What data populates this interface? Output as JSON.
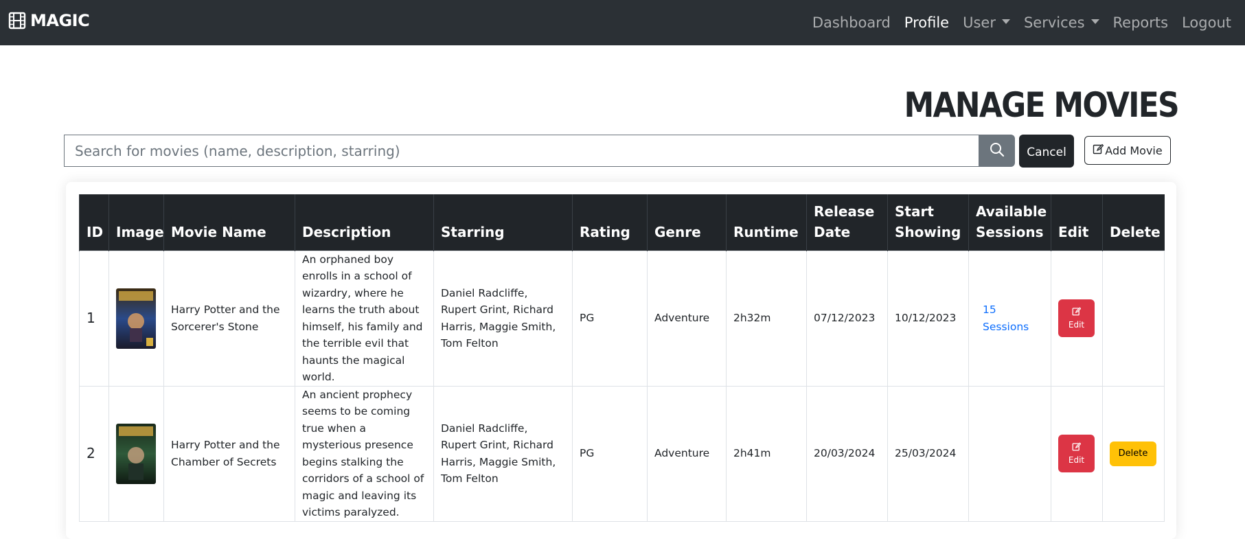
{
  "nav": {
    "brand": "MAGIC",
    "brand_icon": "film-icon",
    "links": {
      "dashboard": "Dashboard",
      "profile": "Profile",
      "user": "User",
      "services": "Services",
      "reports": "Reports",
      "logout": "Logout"
    }
  },
  "page": {
    "title": "MANAGE MOVIES"
  },
  "search": {
    "placeholder": "Search for movies (name, description, starring)",
    "value": "",
    "search_icon": "search-icon",
    "cancel_label": "Cancel",
    "add_label": "Add Movie",
    "add_icon": "edit-icon"
  },
  "table": {
    "headers": [
      "ID",
      "Image",
      "Movie Name",
      "Description",
      "Starring",
      "Rating",
      "Genre",
      "Runtime",
      "Release Date",
      "Start Showing",
      "Available Sessions",
      "Edit",
      "Delete"
    ],
    "rows": [
      {
        "id": "1",
        "name": "Harry Potter and the Sorcerer's Stone",
        "description": "An orphaned boy enrolls in a school of wizardry, where he learns the truth about himself, his family and the terrible evil that haunts the magical world.",
        "starring": "Daniel Radcliffe, Rupert Grint, Richard Harris, Maggie Smith, Tom Felton",
        "rating": "PG",
        "genre": "Adventure",
        "runtime": "2h32m",
        "release": "07/12/2023",
        "start": "10/12/2023",
        "sessions": "15 Sessions",
        "edit_label": "Edit",
        "delete_label": ""
      },
      {
        "id": "2",
        "name": "Harry Potter and the Chamber of Secrets",
        "description": "An ancient prophecy seems to be coming true when a mysterious presence begins stalking the corridors of a school of magic and leaving its victims paralyzed.",
        "starring": "Daniel Radcliffe, Rupert Grint, Richard Harris, Maggie Smith, Tom Felton",
        "rating": "PG",
        "genre": "Adventure",
        "runtime": "2h41m",
        "release": "20/03/2024",
        "start": "25/03/2024",
        "sessions": "",
        "edit_label": "Edit",
        "delete_label": "Delete"
      }
    ]
  },
  "colors": {
    "navbar": "#2b3035",
    "header": "#212529",
    "edit": "#dc3545",
    "delete": "#ffc107",
    "link": "#0d6efd",
    "search_button": "#6c757d"
  }
}
